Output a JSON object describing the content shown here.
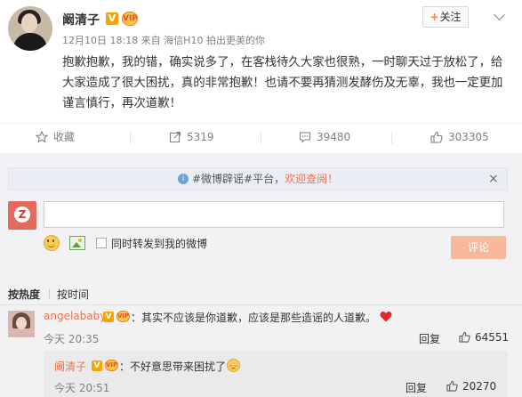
{
  "post": {
    "author": "阚清子",
    "badge_v": "V",
    "badge_vip": "VIP",
    "meta": "12月10日 18:18 来自 海信H10 拍出更美的你",
    "text": "抱歉抱歉，我的错，确实说多了，在客栈待久大家也很熟，一时聊天过于放松了，给大家造成了很大困扰，真的非常抱歉！也请不要再猜测发酵伤及无辜，我也一定更加谨言慎行，再次道歉！",
    "follow_label": "关注",
    "follow_plus": "+"
  },
  "actions": {
    "favorite": "收藏",
    "repost": "5319",
    "comment": "39480",
    "like": "303305"
  },
  "notice": {
    "prefix": "#微博辟谣#平台，",
    "link": "欢迎查阅！",
    "close": "×"
  },
  "composer": {
    "checkbox_label": "同时转发到我的微博",
    "submit_label": "评论",
    "avatar_glyph": "Z"
  },
  "sort": {
    "hot": "按热度",
    "time": "按时间"
  },
  "comments": [
    {
      "user": "angelababy",
      "text": "：其实不应该是你道歉，应该是那些造谣的人道歉。",
      "time": "今天 20:35",
      "reply_label": "回复",
      "likes": "64551"
    },
    {
      "user": "阚清子",
      "text": "：不好意思带来困扰了",
      "time": "今天 20:51",
      "reply_label": "回复",
      "likes": "20270"
    }
  ],
  "colors": {
    "accent": "#eb7350",
    "badge": "#f7a400",
    "submit_disabled": "#f7b89b",
    "heart": "#e0282e"
  },
  "icons": [
    "star-icon",
    "repost-icon",
    "comment-icon",
    "thumbs-up-icon",
    "info-icon",
    "close-icon",
    "emoji-icon",
    "image-icon",
    "heart-icon",
    "blush-emoji"
  ]
}
